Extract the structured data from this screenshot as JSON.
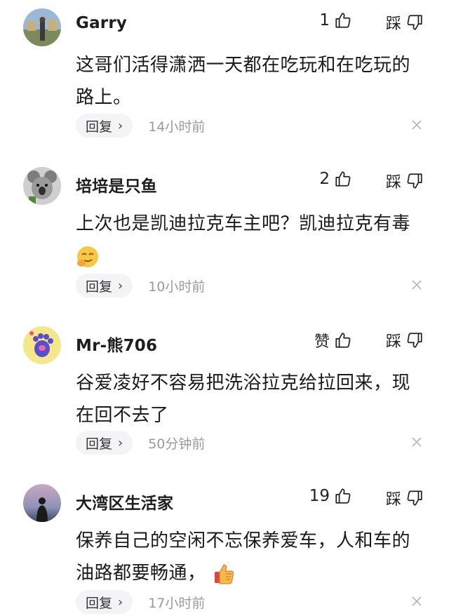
{
  "reply_label": "回复",
  "reply_chevron": "›",
  "dislike_label": "踩",
  "comments": [
    {
      "username": "Garry",
      "likes": "1",
      "text_lines": [
        "这哥们活得潇洒一天都在吃玩和在吃玩的",
        "路上。"
      ],
      "time": "14小时前",
      "avatar_icon": "avatar-photo-garry"
    },
    {
      "username": "培培是只鱼",
      "likes": "2",
      "text_lines": [
        "上次也是凯迪拉克车主吧？凯迪拉克有毒",
        ""
      ],
      "emoji": "smirking-emoji",
      "time": "10小时前",
      "avatar_icon": "avatar-photo-koala"
    },
    {
      "username": "Mr-熊706",
      "likes": "赞",
      "text_lines": [
        "谷爱凌好不容易把洗浴拉克给拉回来，现",
        "在回不去了"
      ],
      "time": "50分钟前",
      "avatar_icon": "avatar-paw"
    },
    {
      "username": "大湾区生活家",
      "likes": "19",
      "text_lines": [
        "保养自己的空闲不忘保养爱车，人和车的",
        "油路都要畅通，"
      ],
      "emoji": "thumbs-up-emoji",
      "time": "17小时前",
      "avatar_icon": "avatar-photo-silhouette"
    }
  ],
  "colors": {
    "text": "#1a1a1a",
    "muted": "#9a9a9a",
    "reply_bg": "#f4f4f6"
  }
}
